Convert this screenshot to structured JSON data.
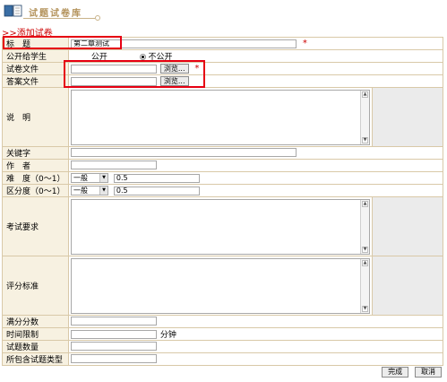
{
  "header": {
    "title": "试题试卷库"
  },
  "section": {
    "title": ">>添加试卷"
  },
  "form": {
    "title": {
      "label": "标　题",
      "value": "第二章测试",
      "required": "*"
    },
    "public": {
      "label": "公开给学生",
      "option_public": "公开",
      "option_private": "不公开",
      "selected": "不公开"
    },
    "paper_file": {
      "label": "试卷文件",
      "value": "",
      "browse": "浏览...",
      "required": "*"
    },
    "answer_file": {
      "label": "答案文件",
      "value": "",
      "browse": "浏览..."
    },
    "description": {
      "label": "说　明",
      "value": ""
    },
    "keywords": {
      "label": "关键字",
      "value": ""
    },
    "author": {
      "label": "作　者",
      "value": ""
    },
    "difficulty": {
      "label": "难　度（0～1）",
      "select": "一般",
      "value": "0.5"
    },
    "discrimination": {
      "label": "区分度（0～1）",
      "select": "一般",
      "value": "0.5"
    },
    "requirements": {
      "label": "考试要求",
      "value": ""
    },
    "grading": {
      "label": "评分标准",
      "value": ""
    },
    "full_score": {
      "label": "满分分数",
      "value": ""
    },
    "time_limit": {
      "label": "时间限制",
      "value": "",
      "unit": "分钟"
    },
    "question_count": {
      "label": "试题数量",
      "value": ""
    },
    "question_types": {
      "label": "所包含试题类型",
      "value": ""
    }
  },
  "actions": {
    "submit": "完成",
    "cancel": "取消"
  },
  "colors": {
    "accent": "#cc0000",
    "highlight": "#e60012",
    "label_bg": "#f7f1e1",
    "border": "#d9c9a8"
  },
  "icons": {
    "logo": "book-icon",
    "scroll_up": "scroll-up-arrow-icon",
    "scroll_down": "scroll-down-arrow-icon",
    "dropdown": "dropdown-arrow-icon"
  }
}
